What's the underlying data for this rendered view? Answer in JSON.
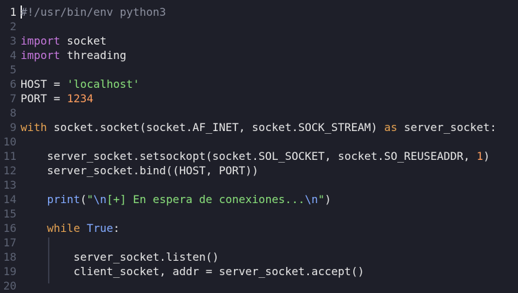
{
  "editor": {
    "lines": [
      {
        "num": "1",
        "tokens": [
          {
            "t": "#!/usr/bin/env python3",
            "c": "comment"
          }
        ]
      },
      {
        "num": "2",
        "tokens": []
      },
      {
        "num": "3",
        "tokens": [
          {
            "t": "import",
            "c": "kw"
          },
          {
            "t": " socket",
            "c": ""
          }
        ]
      },
      {
        "num": "4",
        "tokens": [
          {
            "t": "import",
            "c": "kw"
          },
          {
            "t": " threading",
            "c": ""
          }
        ]
      },
      {
        "num": "5",
        "tokens": []
      },
      {
        "num": "6",
        "tokens": [
          {
            "t": "HOST = ",
            "c": ""
          },
          {
            "t": "'localhost'",
            "c": "str"
          }
        ]
      },
      {
        "num": "7",
        "tokens": [
          {
            "t": "PORT = ",
            "c": ""
          },
          {
            "t": "1234",
            "c": "num"
          }
        ]
      },
      {
        "num": "8",
        "tokens": []
      },
      {
        "num": "9",
        "tokens": [
          {
            "t": "with",
            "c": "kw-orange"
          },
          {
            "t": " socket.socket(socket.AF_INET, socket.SOCK_STREAM) ",
            "c": ""
          },
          {
            "t": "as",
            "c": "kw-orange"
          },
          {
            "t": " server_socket:",
            "c": ""
          }
        ]
      },
      {
        "num": "10",
        "tokens": []
      },
      {
        "num": "11",
        "tokens": [
          {
            "t": "    server_socket.setsockopt(socket.SOL_SOCKET, socket.SO_REUSEADDR, ",
            "c": ""
          },
          {
            "t": "1",
            "c": "num"
          },
          {
            "t": ")",
            "c": ""
          }
        ]
      },
      {
        "num": "12",
        "tokens": [
          {
            "t": "    server_socket.bind((HOST, PORT))",
            "c": ""
          }
        ]
      },
      {
        "num": "13",
        "tokens": []
      },
      {
        "num": "14",
        "tokens": [
          {
            "t": "    ",
            "c": ""
          },
          {
            "t": "print",
            "c": "fn"
          },
          {
            "t": "(",
            "c": ""
          },
          {
            "t": "\"",
            "c": "str"
          },
          {
            "t": "\\n",
            "c": "fn"
          },
          {
            "t": "[+] En espera de conexiones...",
            "c": "str"
          },
          {
            "t": "\\n",
            "c": "fn"
          },
          {
            "t": "\"",
            "c": "str"
          },
          {
            "t": ")",
            "c": ""
          }
        ]
      },
      {
        "num": "15",
        "tokens": []
      },
      {
        "num": "16",
        "tokens": [
          {
            "t": "    ",
            "c": ""
          },
          {
            "t": "while",
            "c": "kw-orange"
          },
          {
            "t": " ",
            "c": ""
          },
          {
            "t": "True",
            "c": "const"
          },
          {
            "t": ":",
            "c": ""
          }
        ]
      },
      {
        "num": "17",
        "tokens": []
      },
      {
        "num": "18",
        "tokens": [
          {
            "t": "        server_socket.listen()",
            "c": ""
          }
        ]
      },
      {
        "num": "19",
        "tokens": [
          {
            "t": "        client_socket, addr = server_socket.accept()",
            "c": ""
          }
        ]
      },
      {
        "num": "20",
        "tokens": []
      }
    ]
  }
}
